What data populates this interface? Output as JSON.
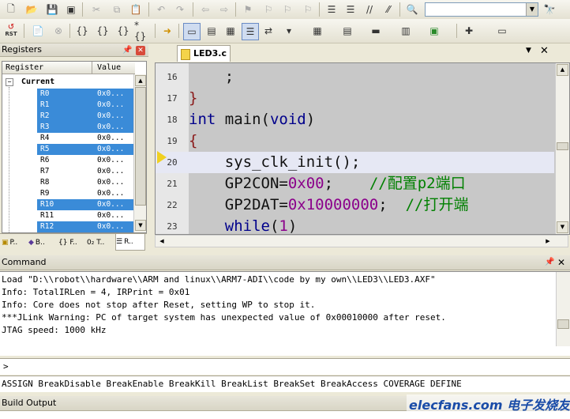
{
  "toolbar1": {
    "search_value": ""
  },
  "toolbar2": {
    "reset_label": "RST"
  },
  "registers": {
    "title": "Registers",
    "col_register": "Register",
    "col_value": "Value",
    "group": "Current",
    "rows": [
      {
        "name": "R0",
        "value": "0x0...",
        "selected": true
      },
      {
        "name": "R1",
        "value": "0x0...",
        "selected": true
      },
      {
        "name": "R2",
        "value": "0x0...",
        "selected": true
      },
      {
        "name": "R3",
        "value": "0x0...",
        "selected": true
      },
      {
        "name": "R4",
        "value": "0x0...",
        "selected": false
      },
      {
        "name": "R5",
        "value": "0x0...",
        "selected": true
      },
      {
        "name": "R6",
        "value": "0x0...",
        "selected": false
      },
      {
        "name": "R7",
        "value": "0x0...",
        "selected": false
      },
      {
        "name": "R8",
        "value": "0x0...",
        "selected": false
      },
      {
        "name": "R9",
        "value": "0x0...",
        "selected": false
      },
      {
        "name": "R10",
        "value": "0x0...",
        "selected": true
      },
      {
        "name": "R11",
        "value": "0x0...",
        "selected": false
      },
      {
        "name": "R12",
        "value": "0x0...",
        "selected": true
      }
    ],
    "tabs": [
      "P..",
      "B..",
      "{} F..",
      "0₂ T..",
      "R.."
    ]
  },
  "editor": {
    "tab_label": "LED3.c",
    "lines": [
      {
        "num": "16",
        "text": "    ;"
      },
      {
        "num": "17",
        "text": "}"
      },
      {
        "num": "18",
        "text": "int main(void)"
      },
      {
        "num": "19",
        "text": "{"
      },
      {
        "num": "20",
        "text": "    sys_clk_init();"
      },
      {
        "num": "21",
        "text": "    GP2CON=0x00;    //配置p2端口"
      },
      {
        "num": "22",
        "text": "    GP2DAT=0x10000000;  //打开端"
      },
      {
        "num": "23",
        "text": "    while(1)"
      }
    ]
  },
  "command": {
    "title": "Command",
    "output": [
      "Load \"D:\\\\robot\\\\hardware\\\\ARM and linux\\\\ARM7-ADI\\\\code by my own\\\\LED3\\\\LED3.AXF\"",
      "Info: TotalIRLen = 4, IRPrint = 0x01",
      "Info: Core does not stop after Reset, setting WP to stop it.",
      "***JLink Warning: PC of target system has unexpected value of 0x00010000 after reset.",
      "JTAG speed: 1000 kHz"
    ],
    "prompt": ">",
    "commands_hint": "ASSIGN BreakDisable BreakEnable BreakKill BreakList BreakSet BreakAccess COVERAGE DEFINE"
  },
  "build_output": {
    "title": "Build Output"
  },
  "watermark": {
    "text": "elecfans.com 电子发烧友"
  }
}
